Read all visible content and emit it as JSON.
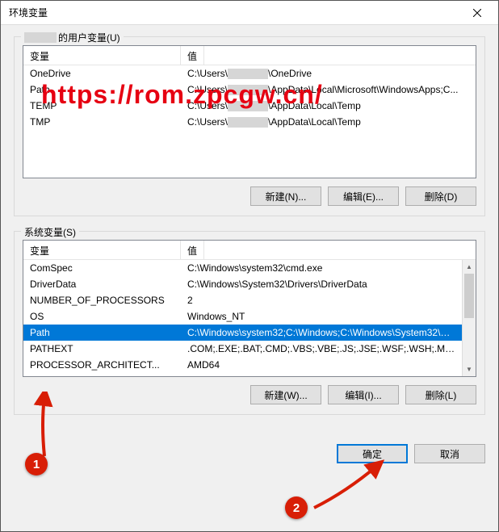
{
  "window": {
    "title": "环境变量"
  },
  "watermark": "https://rom.zpcgw.cn/",
  "user_section": {
    "label_prefix": "的用户变量(U)",
    "columns": {
      "name": "变量",
      "value": "值"
    },
    "rows": [
      {
        "name": "OneDrive",
        "val_prefix": "C:\\Users\\",
        "val_suffix": "\\OneDrive",
        "obscured": true
      },
      {
        "name": "Path",
        "val_prefix": "C:\\Users\\",
        "val_mid": "\\AppData\\Local\\Microsoft\\WindowsApps;C...",
        "obscured": true
      },
      {
        "name": "TEMP",
        "val_prefix": "C:\\Users\\",
        "val_suffix": "\\AppData\\Local\\Temp",
        "obscured": true
      },
      {
        "name": "TMP",
        "val_prefix": "C:\\Users\\",
        "val_suffix": "\\AppData\\Local\\Temp",
        "obscured": true
      }
    ],
    "buttons": {
      "new": "新建(N)...",
      "edit": "编辑(E)...",
      "delete": "删除(D)"
    }
  },
  "sys_section": {
    "label": "系统变量(S)",
    "columns": {
      "name": "变量",
      "value": "值"
    },
    "rows": [
      {
        "name": "ComSpec",
        "value": "C:\\Windows\\system32\\cmd.exe"
      },
      {
        "name": "DriverData",
        "value": "C:\\Windows\\System32\\Drivers\\DriverData"
      },
      {
        "name": "NUMBER_OF_PROCESSORS",
        "value": "2"
      },
      {
        "name": "OS",
        "value": "Windows_NT"
      },
      {
        "name": "Path",
        "value": "C:\\Windows\\system32;C:\\Windows;C:\\Windows\\System32\\Wb...",
        "selected": true
      },
      {
        "name": "PATHEXT",
        "value": ".COM;.EXE;.BAT;.CMD;.VBS;.VBE;.JS;.JSE;.WSF;.WSH;.MSC"
      },
      {
        "name": "PROCESSOR_ARCHITECT...",
        "value": "AMD64"
      }
    ],
    "buttons": {
      "new": "新建(W)...",
      "edit": "编辑(I)...",
      "delete": "删除(L)"
    }
  },
  "dialog_buttons": {
    "ok": "确定",
    "cancel": "取消"
  },
  "annotations": {
    "marker1": "1",
    "marker2": "2"
  }
}
